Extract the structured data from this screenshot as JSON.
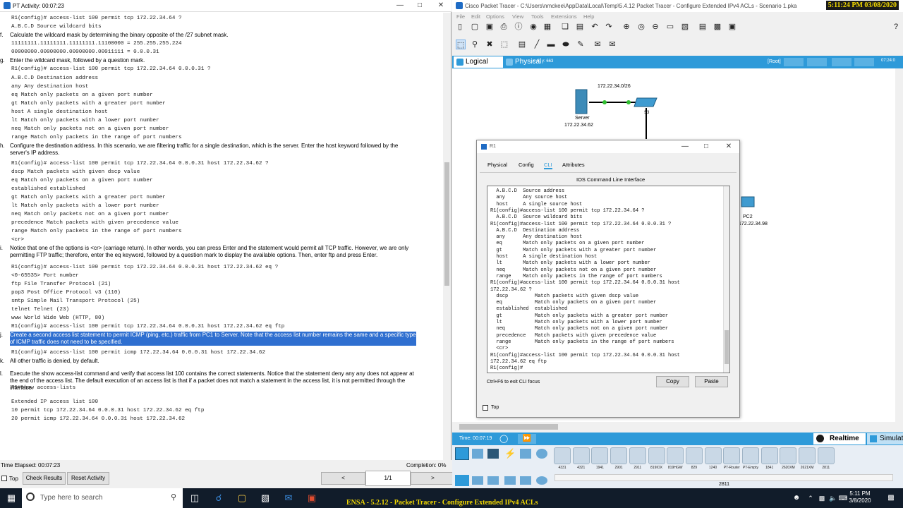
{
  "activity_window": {
    "title": "PT Activity: 00:07:23",
    "lines": [
      {
        "kind": "code",
        "text": "R1(config)# access-list 100 permit tcp 172.22.34.64 ?"
      },
      {
        "kind": "code",
        "text": "A.B.C.D Source wildcard bits"
      },
      {
        "kind": "step",
        "label": "f.",
        "text": "Calculate the wildcard mask by determining the binary opposite of the /27 subnet mask."
      },
      {
        "kind": "code",
        "text": "11111111.11111111.11111111.11100000 = 255.255.255.224"
      },
      {
        "kind": "code",
        "text": "00000000.00000000.00000000.00011111 = 0.0.0.31"
      },
      {
        "kind": "step",
        "label": "g.",
        "text": "Enter the wildcard mask, followed by a question mark."
      },
      {
        "kind": "code",
        "text": "R1(config)# access-list 100 permit tcp 172.22.34.64 0.0.0.31 ?"
      },
      {
        "kind": "code",
        "text": "A.B.C.D Destination address"
      },
      {
        "kind": "code",
        "text": "any Any destination host"
      },
      {
        "kind": "code",
        "text": "eq Match only packets on a given port number"
      },
      {
        "kind": "code",
        "text": "gt Match only packets with a greater port number"
      },
      {
        "kind": "code",
        "text": "host A single destination host"
      },
      {
        "kind": "code",
        "text": "lt Match only packets with a lower port number"
      },
      {
        "kind": "code",
        "text": "neq Match only packets not on a given port number"
      },
      {
        "kind": "code",
        "text": "range Match only packets in the range of port numbers"
      },
      {
        "kind": "step",
        "label": "h.",
        "text": "Configure the destination address. In this scenario, we are filtering traffic for a single destination, which is the server. Enter the host keyword followed by the server's IP address."
      },
      {
        "kind": "code",
        "text": "R1(config)# access-list 100 permit tcp 172.22.34.64 0.0.0.31 host 172.22.34.62 ?"
      },
      {
        "kind": "code",
        "text": "dscp Match packets with given dscp value"
      },
      {
        "kind": "code",
        "text": "eq Match only packets on a given port number"
      },
      {
        "kind": "code",
        "text": "established established"
      },
      {
        "kind": "code",
        "text": "gt Match only packets with a greater port number"
      },
      {
        "kind": "code",
        "text": "lt Match only packets with a lower port number"
      },
      {
        "kind": "code",
        "text": "neq Match only packets not on a given port number"
      },
      {
        "kind": "code",
        "text": "precedence Match packets with given precedence value"
      },
      {
        "kind": "code",
        "text": "range Match only packets in the range of port numbers"
      },
      {
        "kind": "code",
        "text": "<cr>"
      },
      {
        "kind": "step",
        "label": "i.",
        "text": "Notice that one of the options is <cr> (carriage return). In other words, you can press Enter and the statement would permit all TCP traffic. However, we are only permitting FTP traffic; therefore, enter the eq keyword, followed by a question mark to display the available options. Then, enter ftp and press Enter."
      },
      {
        "kind": "code",
        "text": "R1(config)# access-list 100 permit tcp 172.22.34.64 0.0.0.31 host 172.22.34.62 eq ?"
      },
      {
        "kind": "code",
        "text": "<0-65535> Port number"
      },
      {
        "kind": "code",
        "text": "ftp File Transfer Protocol (21)"
      },
      {
        "kind": "code",
        "text": "pop3 Post Office Protocol v3 (110)"
      },
      {
        "kind": "code",
        "text": "smtp Simple Mail Transport Protocol (25)"
      },
      {
        "kind": "code",
        "text": "telnet Telnet (23)"
      },
      {
        "kind": "code",
        "text": "www World Wide Web (HTTP, 80)"
      },
      {
        "kind": "code",
        "text": "R1(config)# access-list 100 permit tcp 172.22.34.64 0.0.0.31 host 172.22.34.62 eq ftp"
      },
      {
        "kind": "step_hl",
        "label": "j.",
        "text": "Create a second access list statement to permit ICMP (ping, etc.) traffic from PC1 to Server. Note that the access list number remains the same and a specific type of ICMP traffic does not need to be specified."
      },
      {
        "kind": "code",
        "text": "R1(config)# access-list 100 permit icmp 172.22.34.64 0.0.0.31 host 172.22.34.62"
      },
      {
        "kind": "step",
        "label": "k.",
        "text": "All other traffic is denied, by default."
      },
      {
        "kind": "step",
        "label": "l.",
        "text": "Execute the show access-list command and verify that access list 100 contains the correct statements. Notice that the statement deny any any does not appear at the end of the access list. The default execution of an access list is that if a packet does not match a statement in the access list, it is not permitted through the interface."
      },
      {
        "kind": "code",
        "text": "R1#show access-lists"
      },
      {
        "kind": "code",
        "text": "Extended IP access list 100"
      },
      {
        "kind": "code",
        "text": "10 permit tcp 172.22.34.64 0.0.0.31 host 172.22.34.62 eq ftp"
      },
      {
        "kind": "code",
        "text": "20 permit icmp 172.22.34.64 0.0.0.31 host 172.22.34.62"
      }
    ],
    "footer": {
      "time_elapsed": "Time Elapsed: 00:07:23",
      "completion": "Completion: 0%",
      "top_label": "Top",
      "check_results": "Check Results",
      "reset_activity": "Reset Activity",
      "prev": "<",
      "page": "1/1",
      "next": ">"
    }
  },
  "packet_tracer": {
    "title": "Cisco Packet Tracer - C:\\Users\\nmckee\\AppData\\Local\\Temp\\5.4.12 Packet Tracer - Configure Extended IPv4 ACLs - Scenario 1.pka",
    "clock": "5:11:24 PM 03/08/2020",
    "menu": [
      "File",
      "Edit",
      "Options",
      "View",
      "Tools",
      "Extensions",
      "Help"
    ],
    "logical_tab": "Logical",
    "physical_tab": "Physical",
    "coords": "x: 8, y: 663",
    "root_label": "[Root]",
    "canvas_time": "07:24:0",
    "topology": {
      "network_label": "172.22.34.0/26",
      "server_label": "Server",
      "server_ip": "172.22.34.62",
      "switch_label": "S3",
      "pc2_label": "PC2",
      "pc2_ip": "172.22.34.98"
    },
    "sim_time": "Time: 00:07:19",
    "realtime": "Realtime",
    "simulation": "Simulation",
    "device_models": [
      "4331",
      "4321",
      "1941",
      "2901",
      "2911",
      "819IOX",
      "819HGW",
      "829",
      "1240",
      "PT-Router",
      "PT-Empty",
      "1841",
      "2620XM",
      "2621XM",
      "2811"
    ],
    "selected_model": "2811"
  },
  "r1_dialog": {
    "title": "R1",
    "tabs": [
      "Physical",
      "Config",
      "CLI",
      "Attributes"
    ],
    "active_tab": "CLI",
    "heading": "IOS Command Line Interface",
    "cli_lines": [
      "  A.B.C.D  Source address",
      "  any      Any source host",
      "  host     A single source host",
      "R1(config)#access-list 100 permit tcp 172.22.34.64 ?",
      "  A.B.C.D  Source wildcard bits",
      "R1(config)#access-list 100 permit tcp 172.22.34.64 0.0.0.31 ?",
      "  A.B.C.D  Destination address",
      "  any      Any destination host",
      "  eq       Match only packets on a given port number",
      "  gt       Match only packets with a greater port number",
      "  host     A single destination host",
      "  lt       Match only packets with a lower port number",
      "  neq      Match only packets not on a given port number",
      "  range    Match only packets in the range of port numbers",
      "R1(config)#access-list 100 permit tcp 172.22.34.64 0.0.0.31 host",
      "172.22.34.62 ?",
      "  dscp         Match packets with given dscp value",
      "  eq           Match only packets on a given port number",
      "  established  established",
      "  gt           Match only packets with a greater port number",
      "  lt           Match only packets with a lower port number",
      "  neq          Match only packets not on a given port number",
      "  precedence   Match packets with given precedence value",
      "  range        Match only packets in the range of port numbers",
      "  <cr>",
      "R1(config)#access-list 100 permit tcp 172.22.34.64 0.0.0.31 host",
      "172.22.34.62 eq ftp",
      "R1(config)#"
    ],
    "hint": "Ctrl+F6 to exit CLI focus",
    "copy": "Copy",
    "paste": "Paste",
    "top_label": "Top"
  },
  "taskbar": {
    "search_placeholder": "Type here to search",
    "time": "5:11 PM",
    "date": "3/8/2020",
    "banner": "ENSA - 5.2.12 - Packet Tracer - Configure Extended IPv4 ACLs"
  },
  "colors": {
    "pt_blue": "#2e9ad9",
    "highlight": "#2f6fd0",
    "clock_yellow": "#f2d800"
  }
}
